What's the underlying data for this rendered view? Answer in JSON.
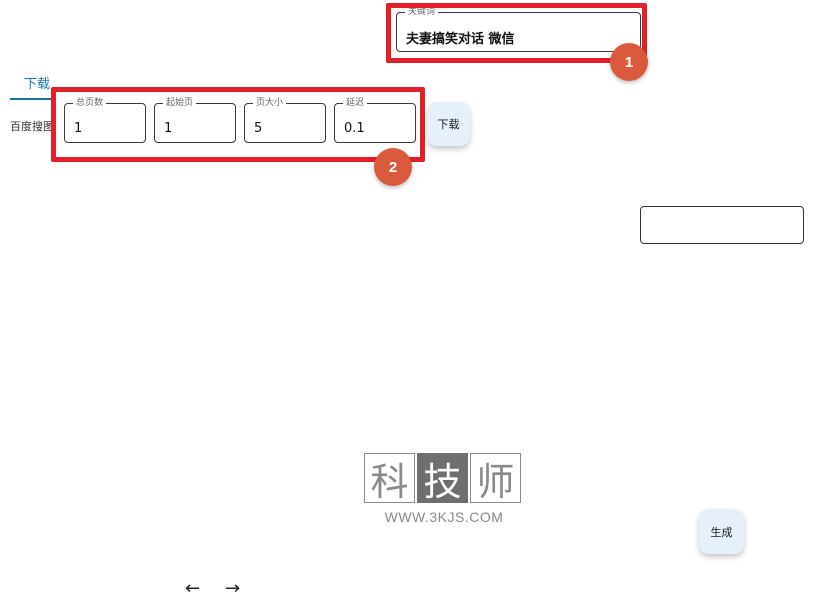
{
  "keyword_field": {
    "label": "关键词",
    "value": "夫妻搞笑对话 微信"
  },
  "tabs": {
    "download": "下载"
  },
  "sidebar": {
    "truncated_label": "百度搜图"
  },
  "params": {
    "total_pages": {
      "label": "总页数",
      "value": "1"
    },
    "start_page": {
      "label": "起始页",
      "value": "1"
    },
    "page_size": {
      "label": "页大小",
      "value": "5"
    },
    "delay": {
      "label": "延迟",
      "value": "0.1"
    }
  },
  "buttons": {
    "download": "下载",
    "generate": "生成"
  },
  "annotations": {
    "badge_1": "1",
    "badge_2": "2"
  },
  "watermark": {
    "chars": [
      "科",
      "技",
      "师"
    ],
    "url": "WWW.3KJS.COM"
  },
  "nav": {
    "back": "←",
    "forward": "→"
  },
  "colors": {
    "annotation_red": "#e3202a",
    "badge_orange": "#d95a3c",
    "tab_blue": "#1a73a8",
    "button_bg": "#e6f0fb"
  }
}
